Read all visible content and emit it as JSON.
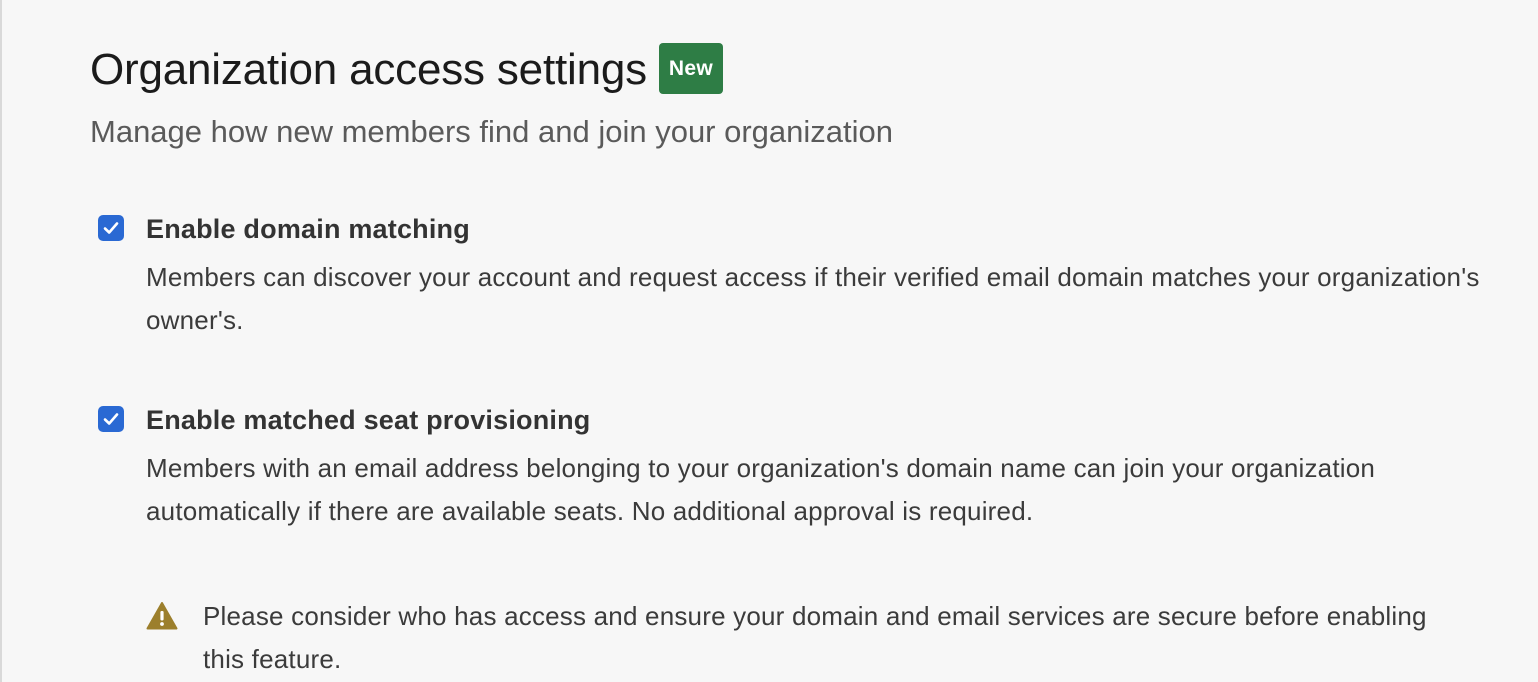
{
  "header": {
    "title": "Organization access settings",
    "badge": "New",
    "subtitle": "Manage how new members find and join your organization"
  },
  "options": [
    {
      "checked": true,
      "label": "Enable domain matching",
      "description": "Members can discover your account and request access if their verified email domain matches your organization's owner's."
    },
    {
      "checked": true,
      "label": "Enable matched seat provisioning",
      "description": "Members with an email address belonging to your organization's domain name can join your organization automatically if there are available seats. No additional approval is required.",
      "warning": {
        "icon": "warning-triangle-icon",
        "text": "Please consider who has access and ensure your domain and email services are secure before enabling this feature."
      }
    }
  ],
  "colors": {
    "background": "#f7f7f7",
    "badge": "#2e7d45",
    "checkbox": "#2a69d3",
    "warning_icon": "#9c7f2c"
  }
}
